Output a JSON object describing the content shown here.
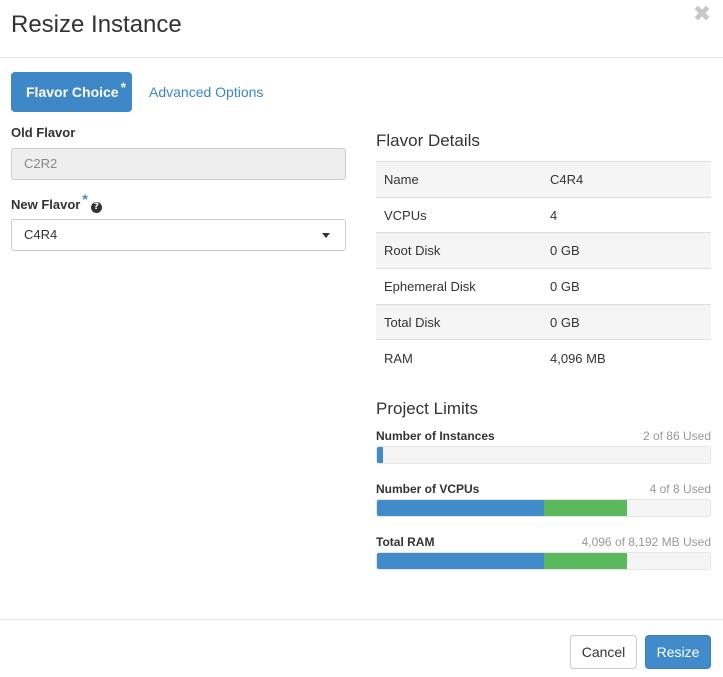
{
  "dialog": {
    "title": "Resize Instance",
    "close_glyph": "✖"
  },
  "tabs": {
    "flavor_choice": "Flavor Choice",
    "required_marker": "*",
    "advanced_options": "Advanced Options"
  },
  "form": {
    "old_flavor_label": "Old Flavor",
    "old_flavor_value": "C2R2",
    "new_flavor_label": "New Flavor",
    "new_flavor_required": "*",
    "new_flavor_help_icon": "question-circle-icon",
    "new_flavor_help_glyph": "?",
    "new_flavor_value": "C4R4"
  },
  "flavor_details": {
    "title": "Flavor Details",
    "rows": [
      {
        "label": "Name",
        "value": "C4R4"
      },
      {
        "label": "VCPUs",
        "value": "4"
      },
      {
        "label": "Root Disk",
        "value": "0 GB"
      },
      {
        "label": "Ephemeral Disk",
        "value": "0 GB"
      },
      {
        "label": "Total Disk",
        "value": "0 GB"
      },
      {
        "label": "RAM",
        "value": "4,096 MB"
      }
    ]
  },
  "project_limits": {
    "title": "Project Limits",
    "items": [
      {
        "label": "Number of Instances",
        "used_text": "2 of 86 Used",
        "current_fraction": 0.018,
        "added_fraction": 0
      },
      {
        "label": "Number of VCPUs",
        "used_text": "4 of 8 Used",
        "current_fraction": 0.5,
        "added_fraction": 0.25
      },
      {
        "label": "Total RAM",
        "used_text": "4,096 of 8,192 MB Used",
        "current_fraction": 0.5,
        "added_fraction": 0.25
      }
    ]
  },
  "footer": {
    "cancel_label": "Cancel",
    "resize_label": "Resize"
  },
  "colors": {
    "primary": "#428bca",
    "added_usage": "#5cb85c",
    "link": "#3a87c7"
  }
}
